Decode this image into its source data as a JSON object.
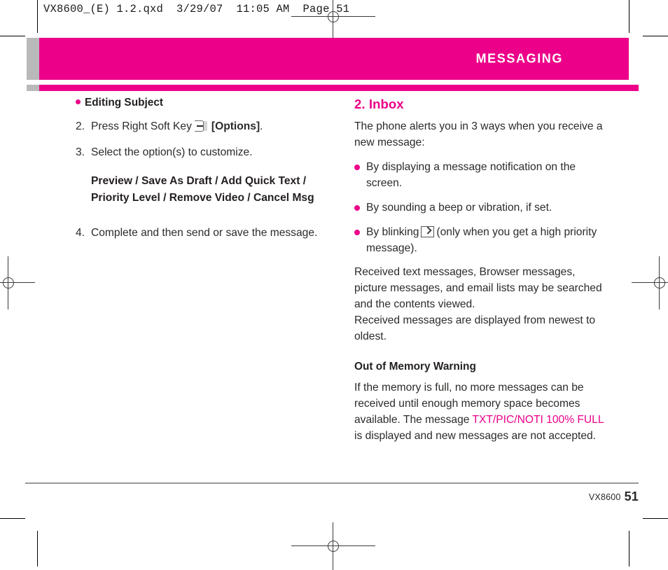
{
  "prepress": {
    "header_line": "VX8600_(E) 1.2.qxd  3/29/07  11:05 AM  Page 51"
  },
  "header": {
    "title": "MESSAGING",
    "band_color": "#ec0089",
    "tab_color": "#b9b9b9"
  },
  "left_column": {
    "bullet_heading": "Editing Subject",
    "steps": [
      {
        "number": "2.",
        "text_before_icon": "Press Right Soft Key",
        "icon": "right-soft-key-icon",
        "bold_label": "[Options]",
        "text_after": "."
      },
      {
        "number": "3.",
        "text_before_icon": "Select the option(s) to customize.",
        "icon": "",
        "bold_label": "",
        "text_after": ""
      }
    ],
    "options_line_1": "Preview / Save As Draft / Add Quick Text /",
    "options_line_2": "Priority Level / Remove Video / Cancel Msg",
    "step_4": {
      "number": "4.",
      "text": "Complete and then send or save the message."
    }
  },
  "right_column": {
    "section_title": "2. Inbox",
    "intro": "The phone alerts you in 3 ways when you receive a new message:",
    "bullets": [
      {
        "text_before_icon": "By displaying a message notification on the screen.",
        "icon": "",
        "text_after_icon": ""
      },
      {
        "text_before_icon": "By sounding a beep or vibration, if set.",
        "icon": "",
        "text_after_icon": ""
      },
      {
        "text_before_icon": "By blinking",
        "icon": "envelope-icon",
        "text_after_icon": "(only when you get a high priority message)."
      }
    ],
    "paragraph_1": "Received text messages, Browser messages, picture messages, and email lists may be searched and the contents viewed.",
    "paragraph_2": "Received messages are displayed from newest to oldest.",
    "sub_heading": "Out of Memory Warning",
    "memory_text_1": "If the memory is full, no more messages can be received until enough memory space becomes available. The message",
    "memory_highlight": "TXT/PIC/NOTI 100% FULL",
    "memory_text_2": "is displayed and new messages are not accepted.",
    "accent_color": "#ec0089"
  },
  "footer": {
    "model": "VX8600",
    "page_number": "51"
  }
}
